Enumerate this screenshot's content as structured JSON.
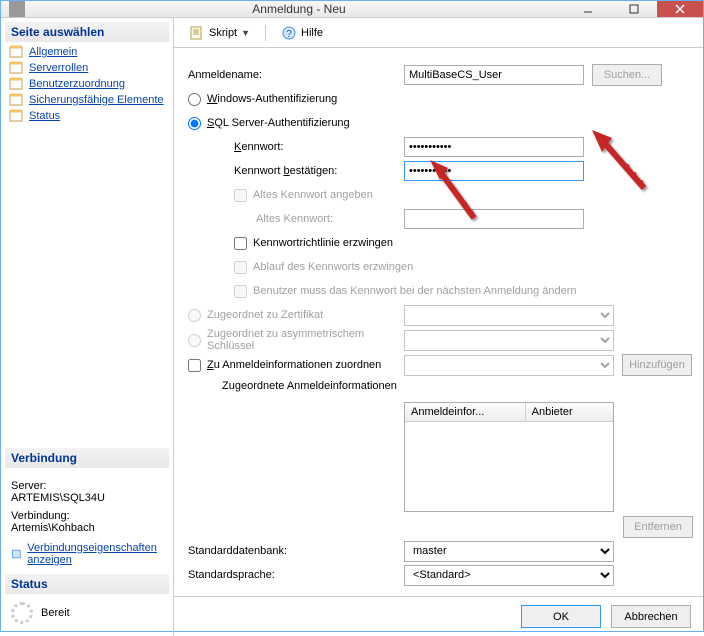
{
  "window": {
    "title": "Anmeldung - Neu"
  },
  "sidebar": {
    "header": "Seite auswählen",
    "items": [
      "Allgemein",
      "Serverrollen",
      "Benutzerzuordnung",
      "Sicherungsfähige Elemente",
      "Status"
    ]
  },
  "connection": {
    "header": "Verbindung",
    "server_label": "Server:",
    "server_value": "ARTEMIS\\SQL34U",
    "conn_label": "Verbindung:",
    "conn_value": "Artemis\\Kohbach",
    "props_link": "Verbindungseigenschaften anzeigen"
  },
  "status": {
    "header": "Status",
    "text": "Bereit"
  },
  "toolbar": {
    "script": "Skript",
    "help": "Hilfe"
  },
  "form": {
    "login_label": "Anmeldename:",
    "login_value": "MultiBaseCS_User",
    "search_btn": "Suchen...",
    "auth_win": "Windows-Authentifizierung",
    "auth_sql": "SQL Server-Authentifizierung",
    "pw_label": "Kennwort:",
    "pw_value": "•••••••••••",
    "pw2_label": "Kennwort bestätigen:",
    "pw2_value": "•••••••••••",
    "oldpw_chk": "Altes Kennwort angeben",
    "oldpw_label": "Altes Kennwort:",
    "policy_chk": "Kennwortrichtlinie erzwingen",
    "expire_chk": "Ablauf des Kennworts erzwingen",
    "mustchg_chk": "Benutzer muss das Kennwort bei der nächsten Anmeldung ändern",
    "map_cert": "Zugeordnet zu Zertifikat",
    "map_key": "Zugeordnet zu asymmetrischem Schlüssel",
    "map_cred": "Zu Anmeldeinformationen zuordnen",
    "add_btn": "Hinzufügen",
    "cred_label": "Zugeordnete Anmeldeinformationen",
    "col1": "Anmeldeinfor...",
    "col2": "Anbieter",
    "remove_btn": "Entfernen",
    "db_label": "Standarddatenbank:",
    "db_value": "master",
    "lang_label": "Standardsprache:",
    "lang_value": "<Standard>"
  },
  "buttons": {
    "ok": "OK",
    "cancel": "Abbrechen"
  }
}
